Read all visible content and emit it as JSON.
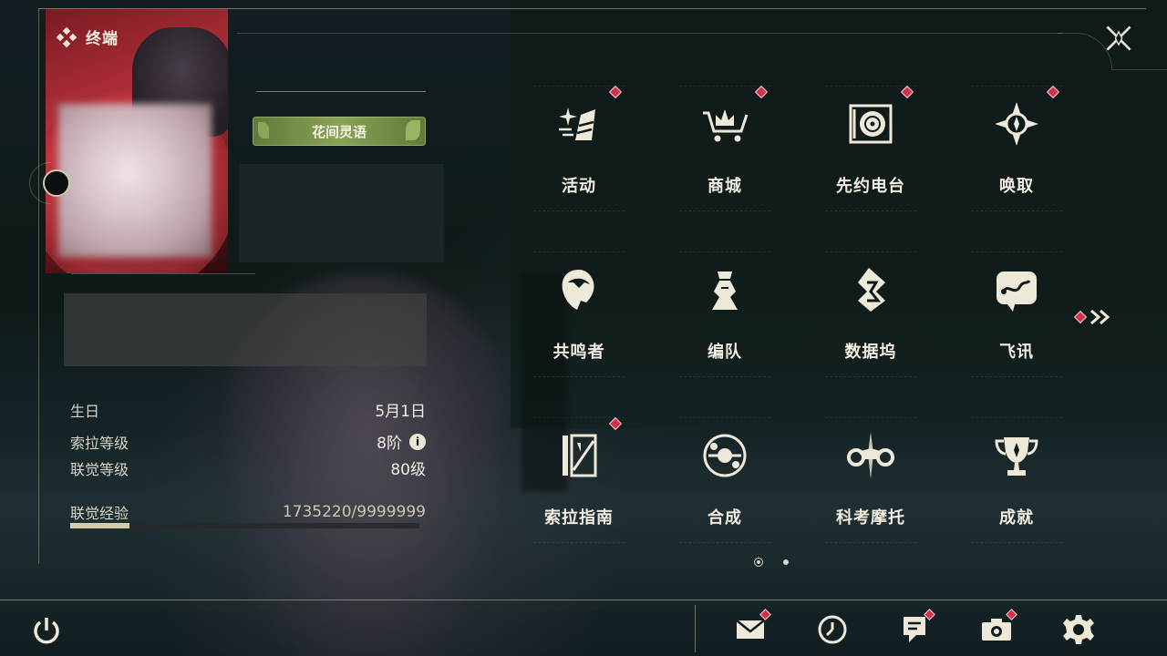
{
  "header": {
    "title": "终端",
    "logo_icon": "terminal-diamond-icon",
    "close_icon": "close-x-icon"
  },
  "profile": {
    "title_badge": "花间灵语",
    "stats": [
      {
        "label": "生日",
        "value": "5月1日"
      },
      {
        "label": "索拉等级",
        "value": "8阶",
        "info_icon": "info-icon"
      },
      {
        "label": "联觉等级",
        "value": "80级"
      },
      {
        "label": "联觉经验",
        "value": "1735220/9999999"
      }
    ],
    "experience": {
      "current": 1735220,
      "max": 9999999,
      "fraction": 0.17
    }
  },
  "menu": {
    "items": [
      {
        "label": "活动",
        "icon": "activity-sparkle-icon",
        "badge": true
      },
      {
        "label": "商城",
        "icon": "shop-cart-icon",
        "badge": true
      },
      {
        "label": "先约电台",
        "icon": "radio-record-icon",
        "badge": true
      },
      {
        "label": "唤取",
        "icon": "convene-compass-icon",
        "badge": true
      },
      {
        "label": "共鸣者",
        "icon": "resonator-portrait-icon",
        "badge": false
      },
      {
        "label": "编队",
        "icon": "team-chess-icon",
        "badge": false
      },
      {
        "label": "数据坞",
        "icon": "data-bank-icon",
        "badge": false
      },
      {
        "label": "飞讯",
        "icon": "chat-message-icon",
        "badge": false
      },
      {
        "label": "索拉指南",
        "icon": "guidebook-icon",
        "badge": true
      },
      {
        "label": "合成",
        "icon": "synthesis-orb-icon",
        "badge": false
      },
      {
        "label": "科考摩托",
        "icon": "motorbike-icon",
        "badge": false
      },
      {
        "label": "成就",
        "icon": "trophy-icon",
        "badge": false
      }
    ],
    "next_page_icon": "chevron-double-right-icon",
    "next_page_badge": true,
    "pages": 2,
    "current_page": 1
  },
  "bottom_bar": {
    "power_icon": "power-icon",
    "buttons": [
      {
        "name": "mail",
        "icon": "mail-icon",
        "badge": true
      },
      {
        "name": "clock",
        "icon": "clock-icon",
        "badge": false
      },
      {
        "name": "notice",
        "icon": "notice-icon",
        "badge": true
      },
      {
        "name": "camera",
        "icon": "camera-icon",
        "badge": true
      },
      {
        "name": "settings",
        "icon": "gear-icon",
        "badge": false
      }
    ]
  },
  "colors": {
    "accent": "#d3304a",
    "text": "#f2ede0",
    "exp_fill": "#d8cba8",
    "title_badge": "#87a456"
  }
}
